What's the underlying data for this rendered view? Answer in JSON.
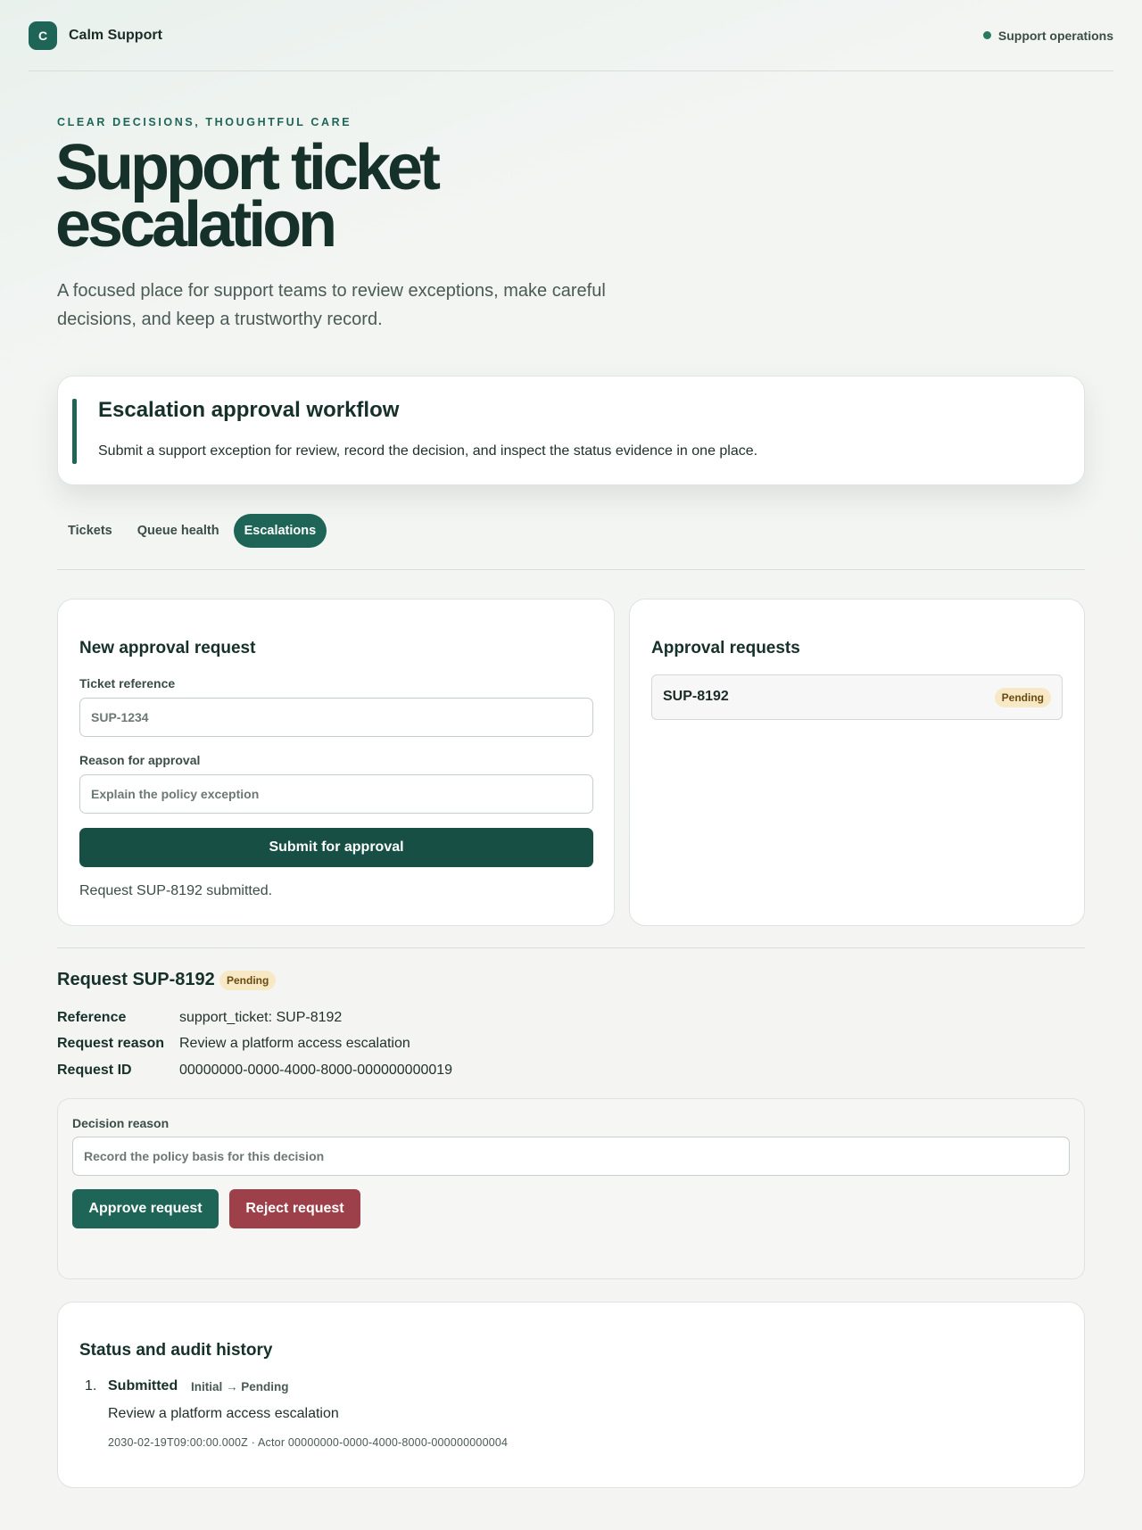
{
  "app": {
    "logo_letter": "C",
    "name": "Calm Support",
    "status_label": "Support operations"
  },
  "hero": {
    "eyebrow": "CLEAR DECISIONS, THOUGHTFUL CARE",
    "title": "Support ticket escalation",
    "subtitle": "A focused place for support teams to review exceptions, make careful decisions, and keep a trustworthy record."
  },
  "workflow": {
    "title": "Escalation approval workflow",
    "description": "Submit a support exception for review, record the decision, and inspect the status evidence in one place."
  },
  "tabs": [
    {
      "label": "Tickets",
      "active": false
    },
    {
      "label": "Queue health",
      "active": false
    },
    {
      "label": "Escalations",
      "active": true
    }
  ],
  "new_request": {
    "title": "New approval request",
    "ticket_label": "Ticket reference",
    "ticket_placeholder": "SUP-1234",
    "reason_label": "Reason for approval",
    "reason_placeholder": "Explain the policy exception",
    "submit_label": "Submit for approval",
    "status_message": "Request SUP-8192 submitted."
  },
  "approval_requests": {
    "title": "Approval requests",
    "items": [
      {
        "id": "SUP-8192",
        "status": "Pending"
      }
    ]
  },
  "request_detail": {
    "title": "Request SUP-8192",
    "status": "Pending",
    "fields": [
      {
        "key": "Reference",
        "value": "support_ticket: SUP-8192"
      },
      {
        "key": "Request reason",
        "value": "Review a platform access escalation"
      },
      {
        "key": "Request ID",
        "value": "00000000-0000-4000-8000-000000000019"
      }
    ],
    "decision_label": "Decision reason",
    "decision_placeholder": "Record the policy basis for this decision",
    "approve_label": "Approve request",
    "reject_label": "Reject request"
  },
  "audit": {
    "title": "Status and audit history",
    "entries": [
      {
        "number": "1.",
        "event": "Submitted",
        "transition": "Initial → Pending",
        "reason": "Review a platform access escalation",
        "meta": "2030-02-19T09:00:00.000Z · Actor 00000000-0000-4000-8000-000000000004"
      }
    ]
  },
  "colors": {
    "accent": "#1f6557",
    "primary_button": "#174f45",
    "reject_button": "#9e4049",
    "pending_badge_bg": "#f7e8c6",
    "pending_badge_text": "#6a4a10"
  }
}
